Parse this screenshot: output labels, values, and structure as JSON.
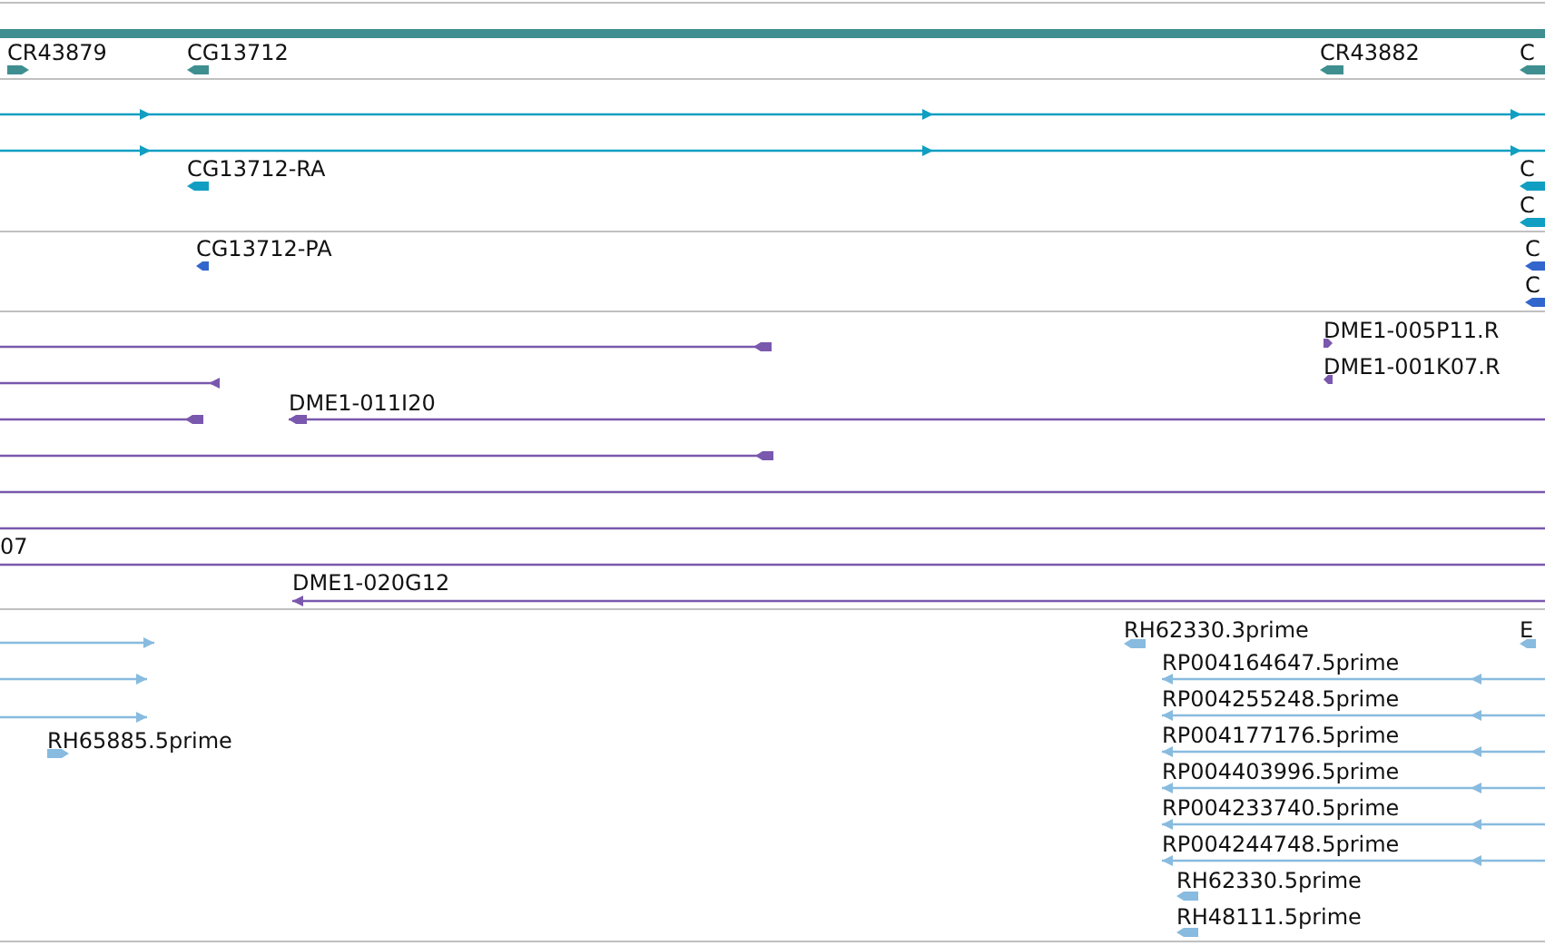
{
  "tracks": [
    {
      "kind": "gene",
      "features": [
        {
          "kind": "block",
          "label": "CR43879",
          "reverse": false
        },
        {
          "kind": "block",
          "label": "CG13712",
          "reverse": true
        },
        {
          "kind": "block",
          "label": "CR43882",
          "reverse": true
        },
        {
          "kind": "block",
          "label": "C",
          "reverse": true
        }
      ]
    },
    {
      "kind": "transcript",
      "features": [
        {
          "kind": "line",
          "reverse": false
        },
        {
          "kind": "line",
          "reverse": false
        },
        {
          "kind": "block",
          "label": "CG13712-RA",
          "reverse": true
        },
        {
          "kind": "block",
          "label": "C",
          "reverse": true
        },
        {
          "kind": "block",
          "label": "C",
          "reverse": true
        }
      ]
    },
    {
      "kind": "protein",
      "features": [
        {
          "kind": "block",
          "label": "CG13712-PA",
          "reverse": true
        },
        {
          "kind": "block",
          "label": "C",
          "reverse": true
        },
        {
          "kind": "block",
          "label": "C",
          "reverse": true
        }
      ]
    },
    {
      "kind": "clone",
      "features": [
        {
          "kind": "line",
          "reverse": true
        },
        {
          "kind": "line",
          "reverse": true
        },
        {
          "kind": "block",
          "label": "DME1-005P11.R",
          "reverse": false
        },
        {
          "kind": "block",
          "label": "DME1-001K07.R",
          "reverse": true
        },
        {
          "kind": "line",
          "reverse": true
        },
        {
          "kind": "line",
          "label": "DME1-011I20",
          "reverse": true
        },
        {
          "kind": "line",
          "reverse": true
        },
        {
          "kind": "line"
        },
        {
          "kind": "line"
        },
        {
          "kind": "line",
          "label": "07"
        },
        {
          "kind": "line",
          "label": "DME1-020G12",
          "reverse": true
        }
      ]
    },
    {
      "kind": "est",
      "features": [
        {
          "kind": "line",
          "reverse": false
        },
        {
          "kind": "line",
          "reverse": false
        },
        {
          "kind": "line",
          "reverse": false
        },
        {
          "kind": "block",
          "label": "RH65885.5prime",
          "reverse": false
        },
        {
          "kind": "block",
          "label": "RH62330.3prime",
          "reverse": true
        },
        {
          "kind": "block",
          "label": "E",
          "reverse": true
        },
        {
          "kind": "line",
          "label": "RP004164647.5prime",
          "reverse": true
        },
        {
          "kind": "line",
          "label": "RP004255248.5prime",
          "reverse": true
        },
        {
          "kind": "line",
          "label": "RP004177176.5prime",
          "reverse": true
        },
        {
          "kind": "line",
          "label": "RP004403996.5prime",
          "reverse": true
        },
        {
          "kind": "line",
          "label": "RP004233740.5prime",
          "reverse": true
        },
        {
          "kind": "line",
          "label": "RP004244748.5prime",
          "reverse": true
        },
        {
          "kind": "block",
          "label": "RH62330.5prime",
          "reverse": true
        },
        {
          "kind": "block",
          "label": "RH48111.5prime",
          "reverse": true
        }
      ]
    }
  ]
}
